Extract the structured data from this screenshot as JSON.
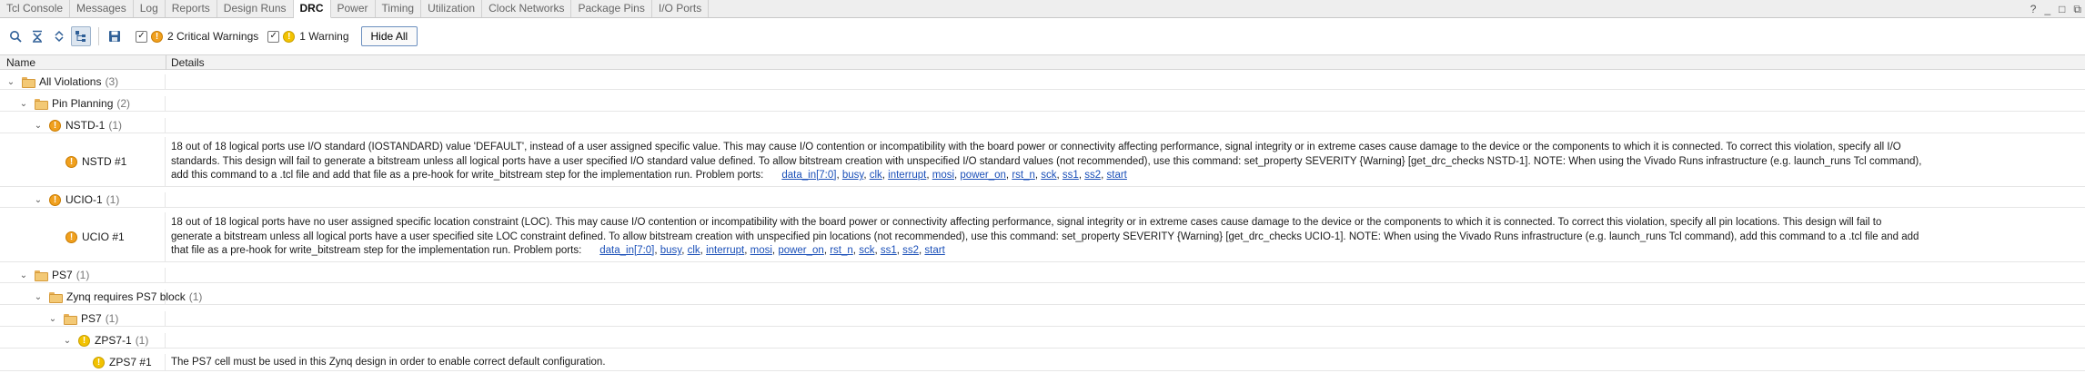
{
  "tabs": [
    "Tcl Console",
    "Messages",
    "Log",
    "Reports",
    "Design Runs",
    "DRC",
    "Power",
    "Timing",
    "Utilization",
    "Clock Networks",
    "Package Pins",
    "I/O Ports"
  ],
  "active_tab": "DRC",
  "window_controls": {
    "help": "?",
    "minimize": "_",
    "restore": "□",
    "maximize": "⧉"
  },
  "toolbar": {
    "critical_warnings_label": "2 Critical Warnings",
    "critical_warnings_checked": true,
    "warnings_label": "1 Warning",
    "warnings_checked": true,
    "hide_all_label": "Hide All",
    "check_mark": "✓"
  },
  "columns": {
    "name": "Name",
    "details": "Details"
  },
  "tree": {
    "all": {
      "label": "All Violations",
      "count": "(3)"
    },
    "pin_planning": {
      "label": "Pin Planning",
      "count": "(2)"
    },
    "nstd_group": {
      "label": "NSTD-1",
      "count": "(1)"
    },
    "nstd_item": {
      "label": "NSTD #1",
      "line1": "18 out of 18 logical ports use I/O standard (IOSTANDARD) value 'DEFAULT', instead of a user assigned specific value. This may cause I/O contention or incompatibility with the board power or connectivity affecting performance, signal integrity or in extreme cases cause damage to the device or the components to which it is connected. To correct this violation, specify all I/O",
      "line2": "standards. This design will fail to generate a bitstream unless all logical ports have a user specified I/O standard value defined. To allow bitstream creation with unspecified I/O standard values (not recommended), use this command: set_property SEVERITY {Warning} [get_drc_checks NSTD-1].  NOTE: When using the Vivado Runs infrastructure (e.g. launch_runs Tcl command),",
      "line3": "add this command to a .tcl file and add that file as a pre-hook for write_bitstream step for the implementation run. Problem ports:",
      "ports": [
        "data_in[7:0]",
        "busy",
        "clk",
        "interrupt",
        "mosi",
        "power_on",
        "rst_n",
        "sck",
        "ss1",
        "ss2",
        "start"
      ]
    },
    "ucio_group": {
      "label": "UCIO-1",
      "count": "(1)"
    },
    "ucio_item": {
      "label": "UCIO #1",
      "line1": "18 out of 18 logical ports have no user assigned specific location constraint (LOC). This may cause I/O contention or incompatibility with the board power or connectivity affecting performance, signal integrity or in extreme cases cause damage to the device or the components to which it is connected. To correct this violation, specify all pin locations. This design will fail to",
      "line2": "generate a bitstream unless all logical ports have a user specified site LOC constraint defined.  To allow bitstream creation with unspecified pin locations (not recommended), use this command: set_property SEVERITY {Warning} [get_drc_checks UCIO-1].  NOTE: When using the Vivado Runs infrastructure (e.g. launch_runs Tcl command), add this command to a .tcl file and add",
      "line3": "that file as a pre-hook for write_bitstream step for the implementation run.  Problem ports:",
      "ports": [
        "data_in[7:0]",
        "busy",
        "clk",
        "interrupt",
        "mosi",
        "power_on",
        "rst_n",
        "sck",
        "ss1",
        "ss2",
        "start"
      ]
    },
    "ps7": {
      "label": "PS7",
      "count": "(1)"
    },
    "zynq": {
      "label": "Zynq requires PS7 block",
      "count": "(1)"
    },
    "ps7_sub": {
      "label": "PS7",
      "count": "(1)"
    },
    "zps7_group": {
      "label": "ZPS7-1",
      "count": "(1)"
    },
    "zps7_item": {
      "label": "ZPS7 #1",
      "details": "The PS7 cell must be used in this Zynq design in order to enable correct default configuration."
    }
  },
  "icon_glyphs": {
    "expanded": "⌄",
    "warning": "!"
  },
  "colors": {
    "critical": "#f0a01e",
    "warning": "#f2c200",
    "link": "#1a4fb8",
    "accent": "#6b8fbf"
  }
}
